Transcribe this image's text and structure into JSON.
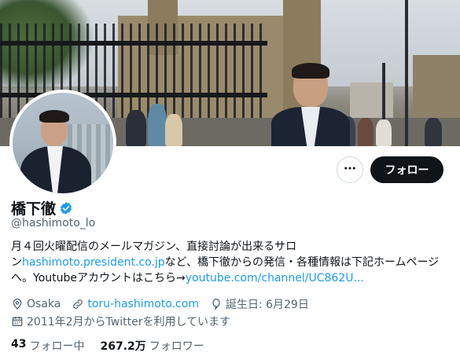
{
  "profile": {
    "name": "橋下徹",
    "handle": "@hashimoto_lo",
    "bio_line1": "月４回火曜配信のメールマガジン、直接討論が出来るサロ",
    "bio_line2_prefix": "ン",
    "bio_link1": "hashimoto.president.co.jp",
    "bio_line2_suffix": "など、橋下徹からの発信・各種情報は下記ホームページ",
    "bio_line3_prefix": "へ。Youtubeアカウントはこちら→",
    "bio_link2": "youtube.com/channel/UC862U...",
    "location": "Osaka",
    "website": "toru-hashimoto.com",
    "birthday": "誕生日: 6月29日",
    "joined": "2011年2月からTwitterを利用しています"
  },
  "actions": {
    "follow_label": "フォロー",
    "more_icon": "ellipsis-icon"
  },
  "stats": {
    "following_count": "43",
    "following_label": "フォロー中",
    "followers_count": "267.2万",
    "followers_label": "フォロワー"
  },
  "colors": {
    "accent": "#1d9bf0",
    "text": "#0f1419",
    "muted": "#536471",
    "follow_bg": "#0f1419"
  }
}
